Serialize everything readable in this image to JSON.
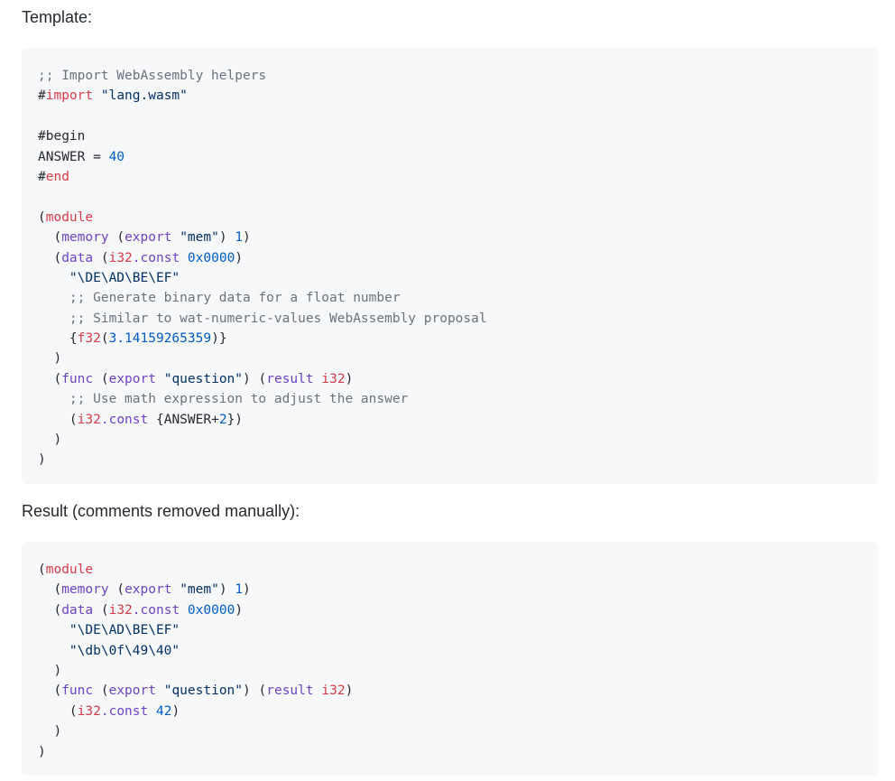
{
  "template_label": "Template:",
  "result_label": "Result (comments removed manually):",
  "template_code": {
    "comment_import": ";; Import WebAssembly helpers",
    "hash": "#",
    "kw_import": "import",
    "str_lang": "\"lang.wasm\"",
    "begin": "#begin",
    "answer_assign": "ANSWER = ",
    "num_40": "40",
    "kw_end": "end",
    "open_paren": "(",
    "kw_module": "module",
    "indent2": "  ",
    "indent4": "    ",
    "p_memory": "memory",
    "p_export": "export",
    "str_mem": "\"mem\"",
    "num_1": "1",
    "p_data": "data",
    "k_i32": "i32",
    "p_const": ".const",
    "num_0x0000": "0x0000",
    "str_deadbeef": "\"\\DE\\AD\\BE\\EF\"",
    "comment_generate": ";; Generate binary data for a float number",
    "comment_similar": ";; Similar to wat-numeric-values WebAssembly proposal",
    "k_f32": "f32",
    "num_pi": "3.14159265359",
    "p_func": "func",
    "str_question": "\"question\"",
    "p_result": "result",
    "comment_math": ";; Use math expression to adjust the answer",
    "answer_expr": "{ANSWER+",
    "num_2": "2",
    "close_brace_paren": "})",
    "close_paren": ")"
  },
  "result_code": {
    "str_db": "\"\\db\\0f\\49\\40\"",
    "num_42": "42"
  }
}
